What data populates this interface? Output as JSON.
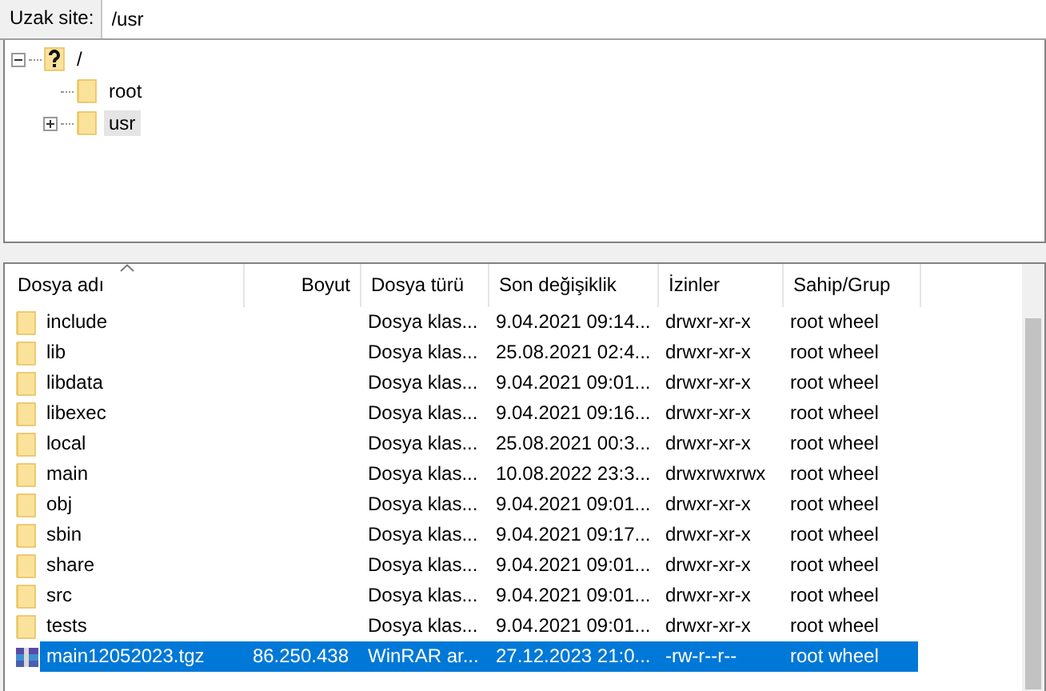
{
  "address_bar": {
    "label": "Uzak site:",
    "value": "/usr"
  },
  "tree": [
    {
      "name": "/",
      "kind": "unknown",
      "expanded": true,
      "selected": false,
      "children": [
        {
          "name": "root",
          "kind": "folder",
          "selected": false
        },
        {
          "name": "usr",
          "kind": "folder",
          "expanded": false,
          "selected": true
        }
      ]
    }
  ],
  "table": {
    "columns": [
      {
        "label": "Dosya adı",
        "sorted": true
      },
      {
        "label": "Boyut",
        "sorted": false
      },
      {
        "label": "Dosya türü",
        "sorted": false
      },
      {
        "label": "Son değişiklik",
        "sorted": false
      },
      {
        "label": "İzinler",
        "sorted": false
      },
      {
        "label": "Sahip/Grup",
        "sorted": false
      }
    ],
    "rows": [
      {
        "kind": "folder",
        "selected": false,
        "cells": [
          "include",
          "",
          "Dosya klas...",
          "9.04.2021 09:14...",
          "drwxr-xr-x",
          "root wheel"
        ]
      },
      {
        "kind": "folder",
        "selected": false,
        "cells": [
          "lib",
          "",
          "Dosya klas...",
          "25.08.2021 02:4...",
          "drwxr-xr-x",
          "root wheel"
        ]
      },
      {
        "kind": "folder",
        "selected": false,
        "cells": [
          "libdata",
          "",
          "Dosya klas...",
          "9.04.2021 09:01...",
          "drwxr-xr-x",
          "root wheel"
        ]
      },
      {
        "kind": "folder",
        "selected": false,
        "cells": [
          "libexec",
          "",
          "Dosya klas...",
          "9.04.2021 09:16...",
          "drwxr-xr-x",
          "root wheel"
        ]
      },
      {
        "kind": "folder",
        "selected": false,
        "cells": [
          "local",
          "",
          "Dosya klas...",
          "25.08.2021 00:3...",
          "drwxr-xr-x",
          "root wheel"
        ]
      },
      {
        "kind": "folder",
        "selected": false,
        "cells": [
          "main",
          "",
          "Dosya klas...",
          "10.08.2022 23:3...",
          "drwxrwxrwx",
          "root wheel"
        ]
      },
      {
        "kind": "folder",
        "selected": false,
        "cells": [
          "obj",
          "",
          "Dosya klas...",
          "9.04.2021 09:01...",
          "drwxr-xr-x",
          "root wheel"
        ]
      },
      {
        "kind": "folder",
        "selected": false,
        "cells": [
          "sbin",
          "",
          "Dosya klas...",
          "9.04.2021 09:17...",
          "drwxr-xr-x",
          "root wheel"
        ]
      },
      {
        "kind": "folder",
        "selected": false,
        "cells": [
          "share",
          "",
          "Dosya klas...",
          "9.04.2021 09:01...",
          "drwxr-xr-x",
          "root wheel"
        ]
      },
      {
        "kind": "folder",
        "selected": false,
        "cells": [
          "src",
          "",
          "Dosya klas...",
          "9.04.2021 09:01...",
          "drwxr-xr-x",
          "root wheel"
        ]
      },
      {
        "kind": "folder",
        "selected": false,
        "cells": [
          "tests",
          "",
          "Dosya klas...",
          "9.04.2021 09:01...",
          "drwxr-xr-x",
          "root wheel"
        ]
      },
      {
        "kind": "archive",
        "selected": true,
        "cells": [
          "main12052023.tgz",
          "86.250.438",
          "WinRAR ar...",
          "27.12.2023 21:0...",
          "-rw-r--r--",
          "root wheel"
        ]
      }
    ]
  }
}
